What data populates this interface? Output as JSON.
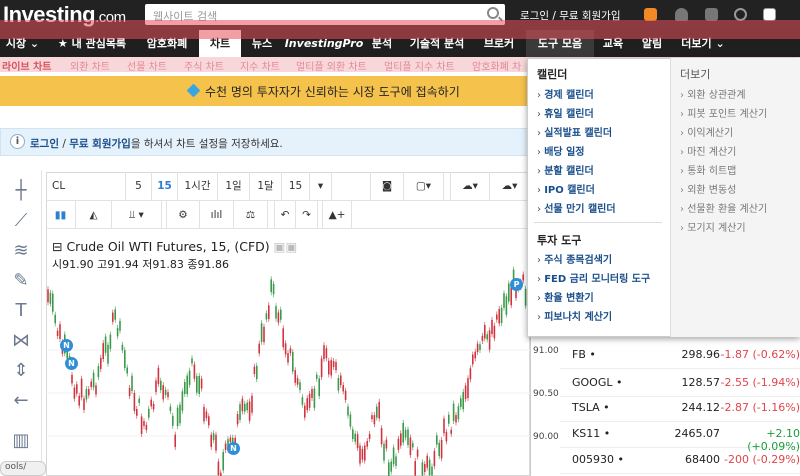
{
  "header": {
    "logo_main": "Investing",
    "logo_suffix": ".com",
    "search_placeholder": "웹사이트 검색",
    "login_text": "로그인 / 무료 회원가입"
  },
  "nav": {
    "items": [
      "시장",
      "내 관심목록",
      "암호화폐",
      "차트",
      "뉴스",
      "InvestingPro",
      "분석",
      "기술적 분석",
      "브로커",
      "도구 모음",
      "교육",
      "알림",
      "더보기"
    ],
    "active": "차트",
    "highlighted": "도구 모음"
  },
  "subnav": {
    "items": [
      "라이브 차트",
      "외환 차트",
      "선물 차트",
      "주식 차트",
      "지수 차트",
      "멀티플 외환 차트",
      "멀티플 지수 차트",
      "암호화폐 차"
    ]
  },
  "banner": {
    "text": "수천 명의 투자자가 신뢰하는 시장 도구에 접속하기"
  },
  "info": {
    "icon": "i",
    "login": "로그인",
    "sep": " / ",
    "register": "무료 회원가입",
    "rest": "을 하셔서 차트 설정을 저장하세요."
  },
  "chart_toolbar": {
    "symbol": "CL",
    "intervals": [
      "5",
      "15",
      "1시간",
      "1일",
      "1달",
      "15"
    ],
    "active_interval": "15"
  },
  "chart": {
    "title": "Crude Oil WTI Futures, 15, (CFD)",
    "ohlc_labels": [
      "시",
      "고",
      "저",
      "종"
    ],
    "ohlc_values": [
      "91.90",
      "91.94",
      "91.83",
      "91.86"
    ],
    "y_ticks": [
      "91.00",
      "90.50",
      "90.00"
    ],
    "markers": [
      "N",
      "N",
      "N",
      "P"
    ]
  },
  "chart_data": {
    "type": "candlestick",
    "title": "Crude Oil WTI Futures, 15, (CFD)",
    "yticks": [
      91.0,
      90.5,
      90.0
    ],
    "last": {
      "open": 91.9,
      "high": 91.94,
      "low": 91.83,
      "close": 91.86
    }
  },
  "watchlist": [
    {
      "symbol": "FB",
      "price": "298.96",
      "change": "-1.87 (-0.62%)",
      "dir": "down"
    },
    {
      "symbol": "GOOGL",
      "price": "128.57",
      "change": "-2.55 (-1.94%)",
      "dir": "down"
    },
    {
      "symbol": "TSLA",
      "price": "244.12",
      "change": "-2.87 (-1.16%)",
      "dir": "down"
    },
    {
      "symbol": "KS11",
      "price": "2465.07",
      "change": "+2.10 (+0.09%)",
      "dir": "up"
    },
    {
      "symbol": "005930",
      "price": "68400",
      "change": "-200 (-0.29%)",
      "dir": "down"
    }
  ],
  "dropdown": {
    "calendar_head": "캘린더",
    "calendar_items": [
      "경제 캘린더",
      "휴일 캘린더",
      "실적발표 캘린더",
      "배당 일정",
      "분할 캘린더",
      "IPO 캘린더",
      "선물 만기 캘린더"
    ],
    "invest_head": "투자 도구",
    "invest_items": [
      "주식 종목검색기",
      "FED 금리 모니터링 도구",
      "환율 변환기",
      "피보나치 계산기"
    ],
    "more_head": "더보기",
    "more_items": [
      "외환 상관관계",
      "피봇 포인트 계산기",
      "이익계산기",
      "마진 계산기",
      "통화 히트맵",
      "외환 변동성",
      "선물환 환율 계산기",
      "모기지 계산기"
    ]
  },
  "bottom_tab": "ools/",
  "colors": {
    "down": "#e0454b",
    "up": "#1a9e3c",
    "accent": "#f5c24c",
    "link": "#1a4f8b"
  }
}
